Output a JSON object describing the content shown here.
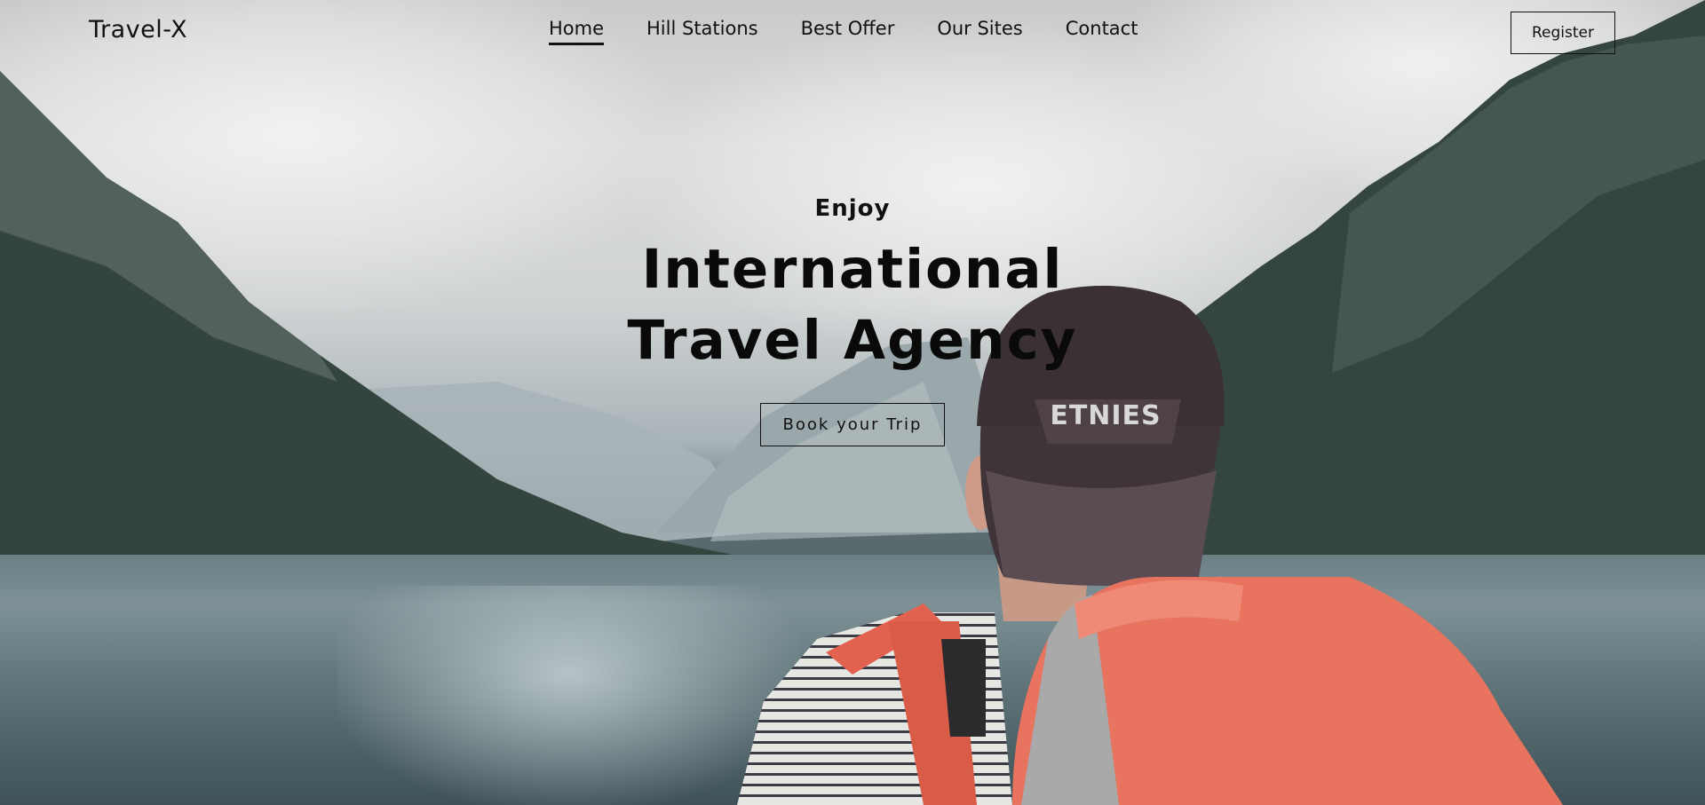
{
  "brand": {
    "name": "Travel-X"
  },
  "nav": {
    "items": [
      {
        "label": "Home",
        "active": true
      },
      {
        "label": "Hill Stations",
        "active": false
      },
      {
        "label": "Best Offer",
        "active": false
      },
      {
        "label": "Our Sites",
        "active": false
      },
      {
        "label": "Contact",
        "active": false
      }
    ],
    "register_label": "Register"
  },
  "hero": {
    "kicker": "Enjoy",
    "title": "International Travel Agency",
    "cta_label": "Book your Trip"
  },
  "background": {
    "description_colors": {
      "sky": "#d8d9d9",
      "mountain_dark": "#2f3f3c",
      "lake": "#6b8085",
      "backpack": "#e8705e",
      "cap": "#3b2f33"
    }
  }
}
